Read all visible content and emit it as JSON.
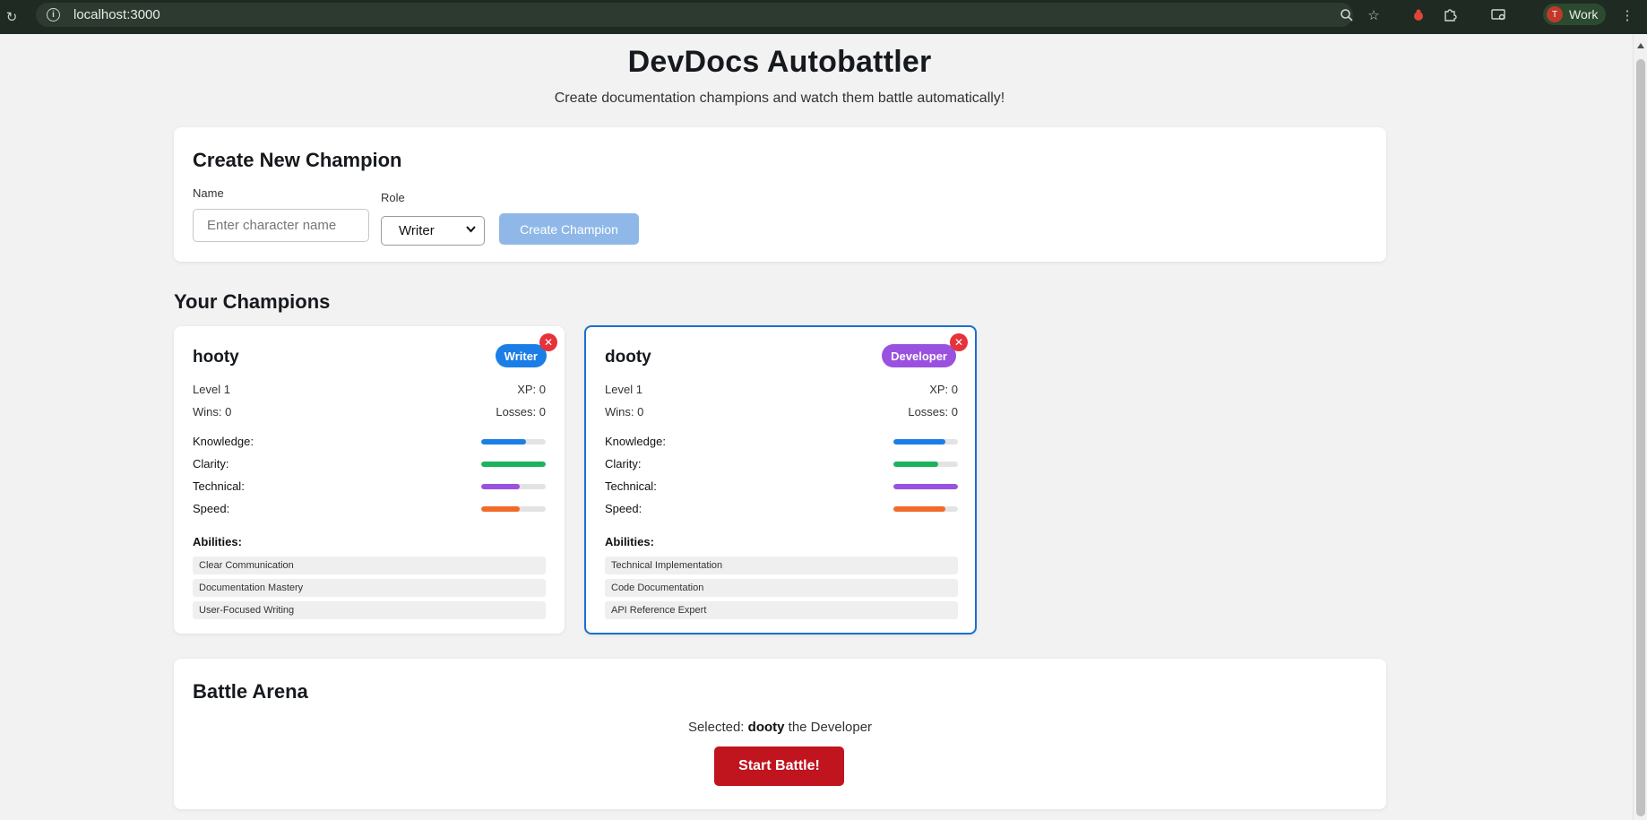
{
  "browser": {
    "url": "localhost:3000",
    "profile_name": "Work",
    "profile_initial": "T",
    "icons": [
      "reload-icon",
      "site-info-icon",
      "zoom-icon",
      "star-icon",
      "extension-puzzle-icon",
      "media-router-icon",
      "menu-dots-icon"
    ]
  },
  "header": {
    "title": "DevDocs Autobattler",
    "subtitle": "Create documentation champions and watch them battle automatically!"
  },
  "create": {
    "title": "Create New Champion",
    "name_label": "Name",
    "name_placeholder": "Enter character name",
    "name_value": "",
    "role_label": "Role",
    "role_value": "Writer",
    "button_label": "Create Champion"
  },
  "champions_title": "Your Champions",
  "champions": [
    {
      "name": "hooty",
      "role": "Writer",
      "role_color": "#1a7ee6",
      "level": "Level 1",
      "xp": "XP: 0",
      "wins": "Wins: 0",
      "losses": "Losses: 0",
      "selected": false,
      "stats": [
        {
          "label": "Knowledge:",
          "value": 0.7,
          "color": "#1a7ee6"
        },
        {
          "label": "Clarity:",
          "value": 1.0,
          "color": "#1cb35c"
        },
        {
          "label": "Technical:",
          "value": 0.6,
          "color": "#9b51e0"
        },
        {
          "label": "Speed:",
          "value": 0.6,
          "color": "#f26a2a"
        }
      ],
      "abilities_label": "Abilities:",
      "abilities": [
        "Clear Communication",
        "Documentation Mastery",
        "User-Focused Writing"
      ]
    },
    {
      "name": "dooty",
      "role": "Developer",
      "role_color": "#9b51e0",
      "level": "Level 1",
      "xp": "XP: 0",
      "wins": "Wins: 0",
      "losses": "Losses: 0",
      "selected": true,
      "stats": [
        {
          "label": "Knowledge:",
          "value": 0.8,
          "color": "#1a7ee6"
        },
        {
          "label": "Clarity:",
          "value": 0.7,
          "color": "#1cb35c"
        },
        {
          "label": "Technical:",
          "value": 1.0,
          "color": "#9b51e0"
        },
        {
          "label": "Speed:",
          "value": 0.8,
          "color": "#f26a2a"
        }
      ],
      "abilities_label": "Abilities:",
      "abilities": [
        "Technical Implementation",
        "Code Documentation",
        "API Reference Expert"
      ]
    }
  ],
  "arena": {
    "title": "Battle Arena",
    "selected_prefix": "Selected:",
    "selected_name": "dooty",
    "selected_suffix": "the Developer",
    "button_label": "Start Battle!"
  }
}
